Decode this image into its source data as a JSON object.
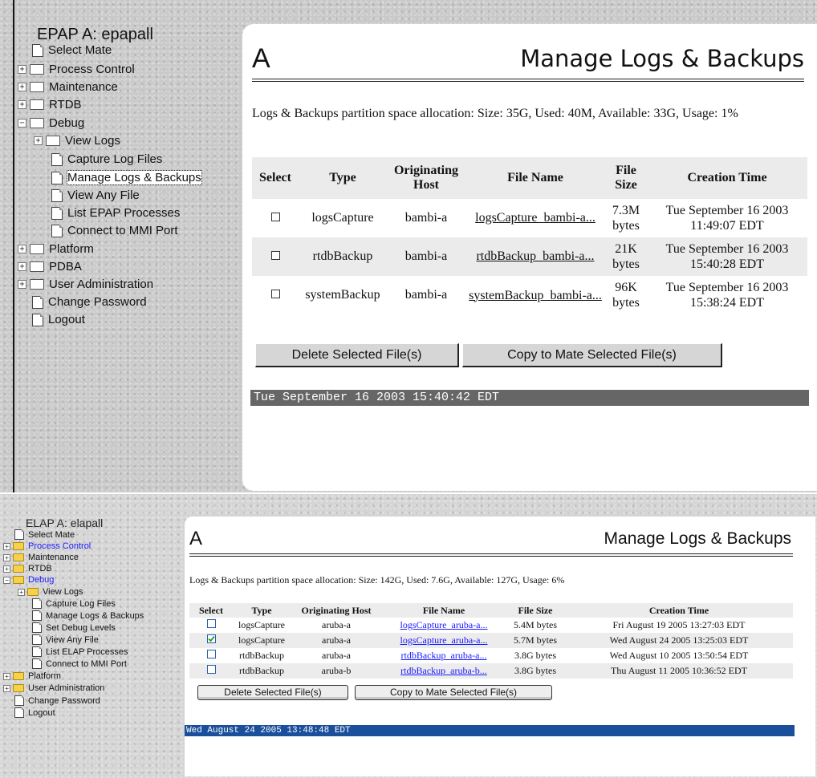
{
  "epap": {
    "tree_title": "EPAP A: epapall",
    "tree": [
      {
        "label": "Select Mate",
        "kind": "doc"
      },
      {
        "label": "Process Control",
        "kind": "folder"
      },
      {
        "label": "Maintenance",
        "kind": "folder"
      },
      {
        "label": "RTDB",
        "kind": "folder"
      },
      {
        "label": "Debug",
        "kind": "folder-open"
      },
      {
        "label": "View Logs",
        "kind": "folder"
      },
      {
        "label": "Capture Log Files",
        "kind": "doc"
      },
      {
        "label": "Manage Logs & Backups",
        "kind": "doc"
      },
      {
        "label": "View Any File",
        "kind": "doc"
      },
      {
        "label": "List EPAP Processes",
        "kind": "doc"
      },
      {
        "label": "Connect to MMI Port",
        "kind": "doc"
      },
      {
        "label": "Platform",
        "kind": "folder"
      },
      {
        "label": "PDBA",
        "kind": "folder"
      },
      {
        "label": "User Administration",
        "kind": "folder"
      },
      {
        "label": "Change Password",
        "kind": "doc"
      },
      {
        "label": "Logout",
        "kind": "doc"
      }
    ],
    "letter": "A",
    "page_title": "Manage Logs & Backups",
    "partition_info": "Logs & Backups partition space allocation: Size: 35G, Used: 40M, Available: 33G, Usage: 1%",
    "columns": [
      "Select",
      "Type",
      "Originating Host",
      "File Name",
      "File Size",
      "Creation Time"
    ],
    "rows": [
      {
        "checked": false,
        "type": "logsCapture",
        "host": "bambi-a",
        "file": "logsCapture_bambi-a...",
        "size": "7.3M bytes",
        "time": "Tue September 16 2003 11:49:07 EDT"
      },
      {
        "checked": false,
        "type": "rtdbBackup",
        "host": "bambi-a",
        "file": "rtdbBackup_bambi-a...",
        "size": "21K bytes",
        "time": "Tue September 16 2003 15:40:28 EDT"
      },
      {
        "checked": false,
        "type": "systemBackup",
        "host": "bambi-a",
        "file": "systemBackup_bambi-a...",
        "size": "96K bytes",
        "time": "Tue September 16 2003 15:38:24 EDT"
      }
    ],
    "delete_btn": "Delete Selected File(s)",
    "copy_btn": "Copy to Mate Selected File(s)",
    "status": "Tue September 16 2003 15:40:42 EDT",
    "status_bg": "#666666"
  },
  "elap": {
    "tree_title": "ELAP A: elapall",
    "tree": [
      {
        "label": "Select Mate",
        "kind": "doc"
      },
      {
        "label": "Process Control",
        "kind": "folder"
      },
      {
        "label": "Maintenance",
        "kind": "folder"
      },
      {
        "label": "RTDB",
        "kind": "folder"
      },
      {
        "label": "Debug",
        "kind": "folder-open"
      },
      {
        "label": "View Logs",
        "kind": "folder"
      },
      {
        "label": "Capture Log Files",
        "kind": "doc"
      },
      {
        "label": "Manage Logs & Backups",
        "kind": "doc"
      },
      {
        "label": "Set Debug Levels",
        "kind": "doc"
      },
      {
        "label": "View Any File",
        "kind": "doc"
      },
      {
        "label": "List ELAP Processes",
        "kind": "doc"
      },
      {
        "label": "Connect to MMI Port",
        "kind": "doc"
      },
      {
        "label": "Platform",
        "kind": "folder"
      },
      {
        "label": "User Administration",
        "kind": "folder"
      },
      {
        "label": "Change Password",
        "kind": "doc"
      },
      {
        "label": "Logout",
        "kind": "doc"
      }
    ],
    "letter": "A",
    "page_title": "Manage Logs & Backups",
    "partition_info": "Logs & Backups partition space allocation: Size: 142G, Used: 7.6G, Available: 127G, Usage: 6%",
    "columns": [
      "Select",
      "Type",
      "Originating Host",
      "File Name",
      "File Size",
      "Creation Time"
    ],
    "rows": [
      {
        "checked": false,
        "type": "logsCapture",
        "host": "aruba-a",
        "file": "logsCapture_aruba-a...",
        "size": "5.4M bytes",
        "time": "Fri August 19 2005 13:27:03 EDT"
      },
      {
        "checked": true,
        "type": "logsCapture",
        "host": "aruba-a",
        "file": "logsCapture_aruba-a...",
        "size": "5.7M bytes",
        "time": "Wed August 24 2005 13:25:03 EDT"
      },
      {
        "checked": false,
        "type": "rtdbBackup",
        "host": "aruba-a",
        "file": "rtdbBackup_aruba-a...",
        "size": "3.8G bytes",
        "time": "Wed August 10 2005 13:50:54 EDT"
      },
      {
        "checked": false,
        "type": "rtdbBackup",
        "host": "aruba-b",
        "file": "rtdbBackup_aruba-b...",
        "size": "3.8G bytes",
        "time": "Thu August 11 2005 10:36:52 EDT"
      }
    ],
    "delete_btn": "Delete Selected File(s)",
    "copy_btn": "Copy to Mate Selected File(s)",
    "status": "Wed August 24 2005 13:48:48 EDT",
    "status_bg": "#1a4f9c",
    "link_color": "#1a1aff"
  }
}
